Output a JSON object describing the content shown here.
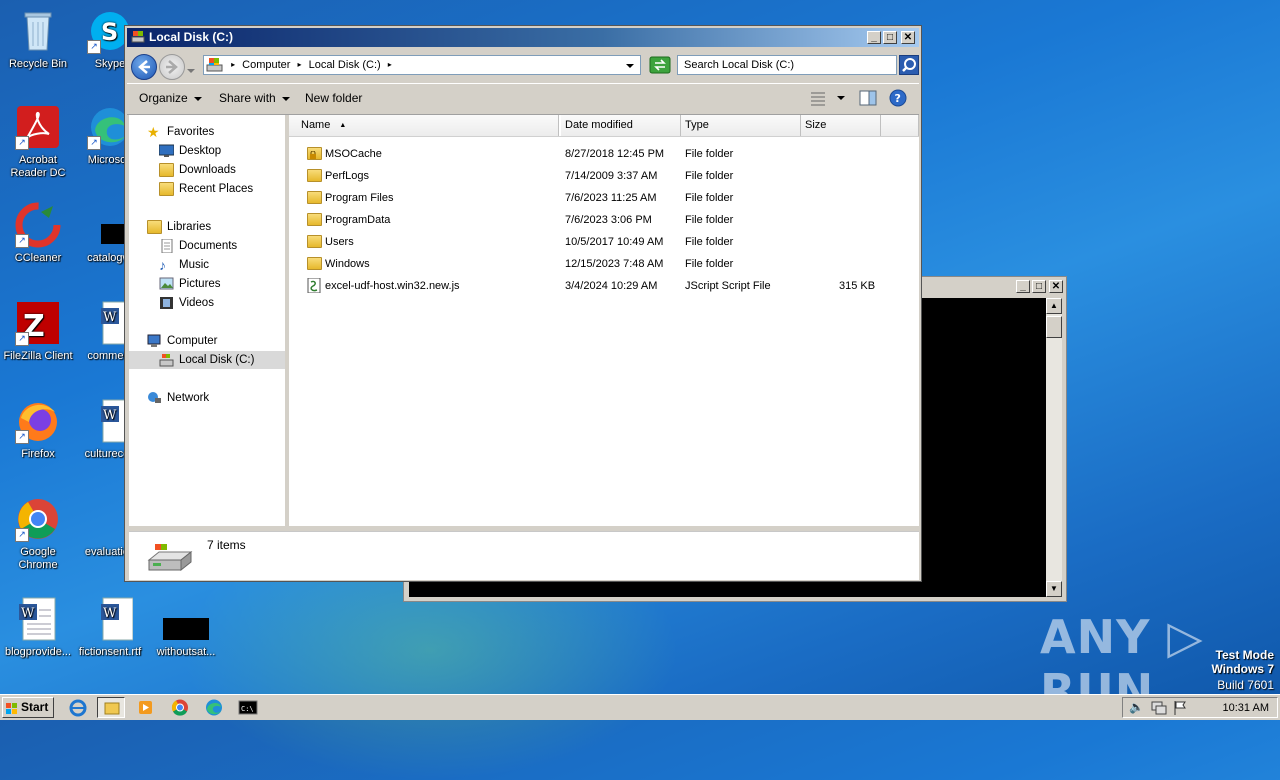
{
  "desktop": {
    "icons": [
      {
        "label": "Recycle Bin",
        "icon": "recycle-bin-icon"
      },
      {
        "label": "Skype",
        "icon": "skype-icon"
      },
      {
        "label": "Acrobat Reader DC",
        "icon": "acrobat-icon"
      },
      {
        "label": "Microsoft",
        "icon": "edge-icon"
      },
      {
        "label": "CCleaner",
        "icon": "ccleaner-icon"
      },
      {
        "label": "catalogwi",
        "icon": "black-file-icon"
      },
      {
        "label": "FileZilla Client",
        "icon": "filezilla-icon"
      },
      {
        "label": "comment",
        "icon": "word-doc-icon"
      },
      {
        "label": "Firefox",
        "icon": "firefox-icon"
      },
      {
        "label": "culturecon",
        "icon": "word-doc-icon"
      },
      {
        "label": "Google Chrome",
        "icon": "chrome-icon"
      },
      {
        "label": "evaluation",
        "icon": "blank-icon"
      },
      {
        "label": "blogprovide...",
        "icon": "word-doc-icon"
      },
      {
        "label": "fictionsent.rtf",
        "icon": "word-doc-icon"
      },
      {
        "label": "withoutsat...",
        "icon": "black-file-icon"
      }
    ],
    "watermark": {
      "logo": "ANY ▷ RUN",
      "line1": "Test Mode",
      "line2": "Windows 7",
      "line3": "Build 7601"
    }
  },
  "window": {
    "title": "Local Disk (C:)",
    "controls": {
      "minimize": "_",
      "maximize": "□",
      "close": "✕"
    }
  },
  "address": {
    "crumbs": [
      "Computer",
      "Local Disk (C:)"
    ],
    "search_placeholder": "Search Local Disk (C:)"
  },
  "toolbar": {
    "organize": "Organize",
    "share": "Share with",
    "new_folder": "New folder"
  },
  "nav": {
    "favorites": "Favorites",
    "desktop": "Desktop",
    "downloads": "Downloads",
    "recent": "Recent Places",
    "libraries": "Libraries",
    "documents": "Documents",
    "music": "Music",
    "pictures": "Pictures",
    "videos": "Videos",
    "computer": "Computer",
    "local_disk": "Local Disk (C:)",
    "network": "Network"
  },
  "columns": {
    "name": "Name",
    "date": "Date modified",
    "type": "Type",
    "size": "Size"
  },
  "files": [
    {
      "name": "MSOCache",
      "date": "8/27/2018 12:45 PM",
      "type": "File folder",
      "size": "",
      "icon": "locked-folder-icon"
    },
    {
      "name": "PerfLogs",
      "date": "7/14/2009 3:37 AM",
      "type": "File folder",
      "size": "",
      "icon": "folder-icon"
    },
    {
      "name": "Program Files",
      "date": "7/6/2023 11:25 AM",
      "type": "File folder",
      "size": "",
      "icon": "folder-icon"
    },
    {
      "name": "ProgramData",
      "date": "7/6/2023 3:06 PM",
      "type": "File folder",
      "size": "",
      "icon": "folder-icon"
    },
    {
      "name": "Users",
      "date": "10/5/2017 10:49 AM",
      "type": "File folder",
      "size": "",
      "icon": "folder-icon"
    },
    {
      "name": "Windows",
      "date": "12/15/2023 7:48 AM",
      "type": "File folder",
      "size": "",
      "icon": "folder-icon"
    },
    {
      "name": "excel-udf-host.win32.new.js",
      "date": "3/4/2024 10:29 AM",
      "type": "JScript Script File",
      "size": "315 KB",
      "icon": "script-file-icon"
    }
  ],
  "status": {
    "items": "7 items"
  },
  "taskbar": {
    "start": "Start",
    "time": "10:31 AM"
  }
}
